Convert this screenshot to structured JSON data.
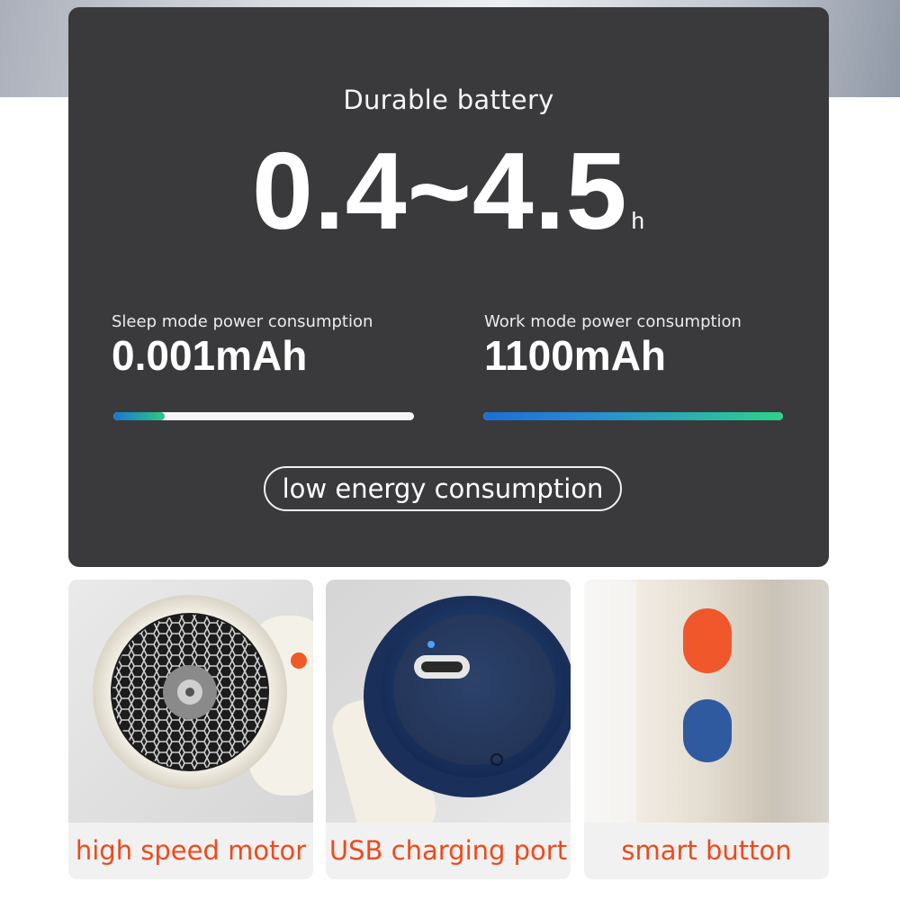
{
  "banner": {
    "title": "Durable battery",
    "range_value": "0.4~4.5",
    "range_unit": "h"
  },
  "stats": [
    {
      "label": "Sleep mode power consumption",
      "value": "0.001mAh",
      "bar_fraction": 0.17
    },
    {
      "label": "Work mode power consumption",
      "value": "1100mAh",
      "bar_fraction": 1.0
    }
  ],
  "badge": "low energy consumption",
  "features": [
    {
      "caption": "high speed motor",
      "icon": "motor-fan"
    },
    {
      "caption": "USB charging port",
      "icon": "usb-c-port"
    },
    {
      "caption": "smart button",
      "icon": "power-buttons"
    }
  ],
  "colors": {
    "panel": "#3a3a3c",
    "caption_accent": "#ee4a1c",
    "button_orange": "#f0572a",
    "button_blue": "#2f5aa0"
  }
}
